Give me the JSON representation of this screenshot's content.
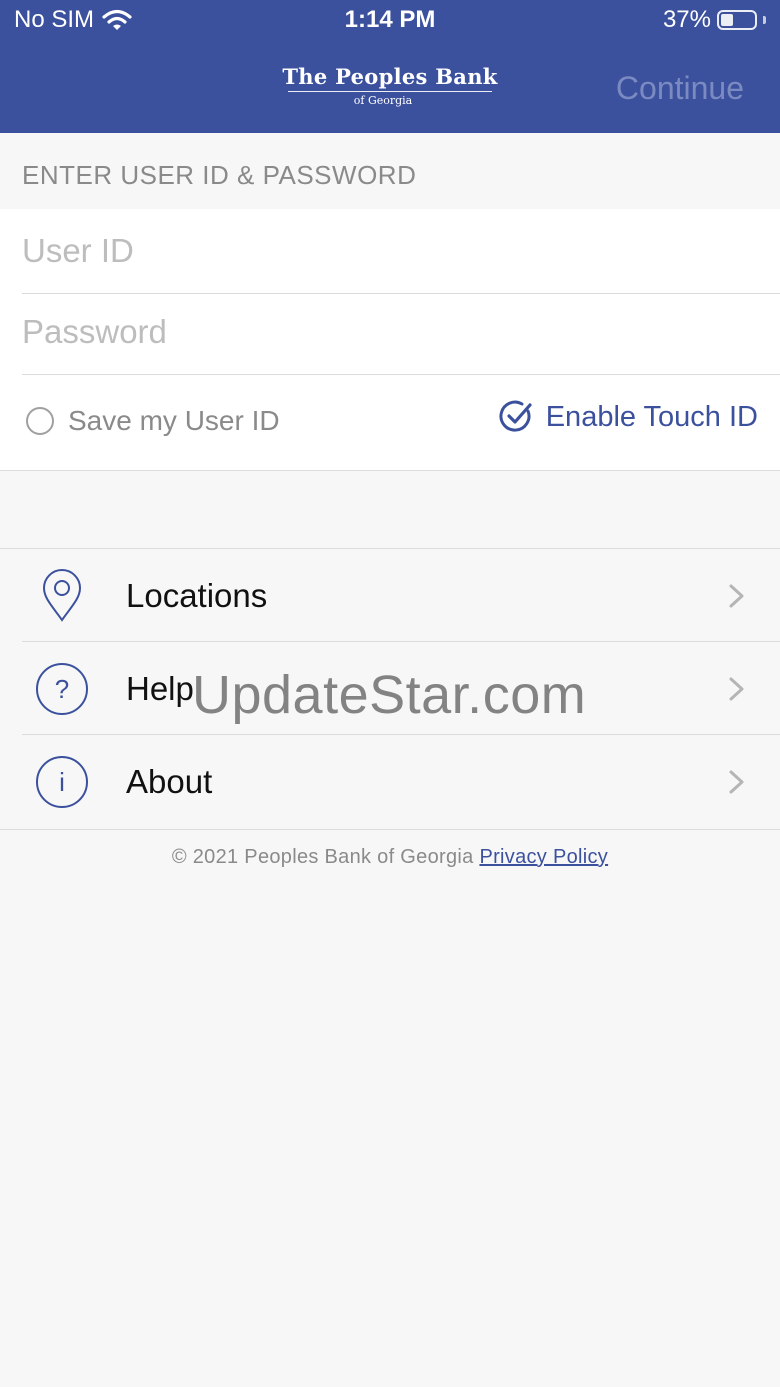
{
  "status_bar": {
    "carrier": "No SIM",
    "time": "1:14 PM",
    "battery": "37%"
  },
  "header": {
    "logo_main": "The Peoples Bank",
    "logo_sub": "of Georgia",
    "continue_label": "Continue"
  },
  "login": {
    "section_title": "ENTER USER ID & PASSWORD",
    "user_id_placeholder": "User ID",
    "password_placeholder": "Password",
    "save_user_label": "Save my User ID",
    "touch_id_label": "Enable Touch ID"
  },
  "menu": {
    "items": [
      {
        "label": "Locations",
        "icon": "location-pin-icon"
      },
      {
        "label": "Help",
        "icon": "question-circle-icon"
      },
      {
        "label": "About",
        "icon": "info-circle-icon"
      }
    ]
  },
  "footer": {
    "copyright": "© 2021 Peoples Bank of Georgia",
    "privacy_link": "Privacy Policy"
  },
  "watermark": "UpdateStar.com",
  "colors": {
    "brand": "#3c519e",
    "background": "#f7f7f7"
  }
}
